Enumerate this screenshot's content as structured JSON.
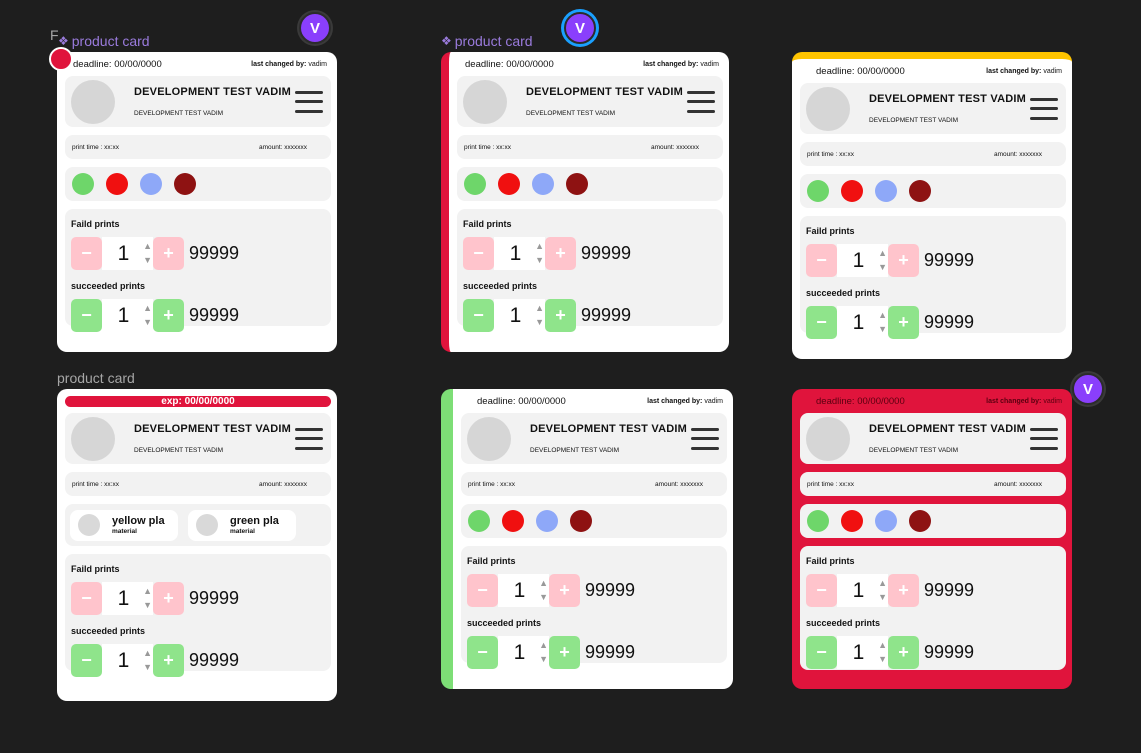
{
  "frame_labels": {
    "top_left_clipped": "F",
    "component_1": "product card",
    "component_2": "product card",
    "plain": "product card"
  },
  "avatars": {
    "initial": "V"
  },
  "card": {
    "deadline": "deadline: 00/00/0000",
    "last_changed_prefix": "last changed by:",
    "last_changed_user": "vadim",
    "expiry": "exp: 00/00/0000",
    "title": "DEVELOPMENT TEST VADIM",
    "subtitle": "DEVELOPMENT TEST VADIM",
    "print_time": "print time : xx:xx",
    "amount": "amount: xxxxxxx",
    "failed_label": "Faild prints",
    "succeeded_label": "succeeded prints",
    "minus": "−",
    "plus": "+",
    "arrows": "▲\n▼",
    "failed_value": "1",
    "succeeded_value": "1",
    "failed_count": "99999",
    "succeeded_count": "99999"
  },
  "color_swatches": [
    "#6ed66a",
    "#f01010",
    "#8ea8f8",
    "#8e1212"
  ],
  "materials": [
    {
      "name": "yellow pla",
      "type": "material"
    },
    {
      "name": "green pla",
      "type": "material"
    }
  ],
  "colors": {
    "accent_red": "#e0143c",
    "accent_green": "#7dde76",
    "accent_yellow": "#ffc400",
    "avatar_purple": "#8a3ffc"
  }
}
